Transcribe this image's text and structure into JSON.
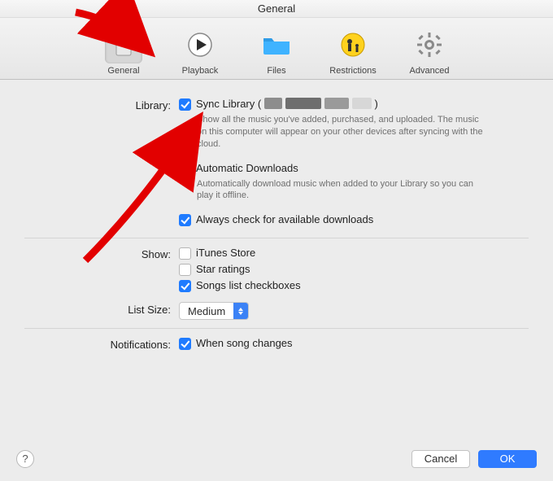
{
  "window": {
    "title": "General"
  },
  "toolbar": {
    "items": [
      {
        "key": "general",
        "label": "General",
        "selected": true
      },
      {
        "key": "playback",
        "label": "Playback",
        "selected": false
      },
      {
        "key": "files",
        "label": "Files",
        "selected": false
      },
      {
        "key": "restrictions",
        "label": "Restrictions",
        "selected": false
      },
      {
        "key": "advanced",
        "label": "Advanced",
        "selected": false
      }
    ]
  },
  "sections": {
    "library": {
      "label": "Library:",
      "sync": {
        "label_prefix": "Sync Library (",
        "label_suffix": ")",
        "checked": true,
        "desc": "Show all the music you've added, purchased, and uploaded. The music on this computer will appear on your other devices after syncing with the cloud."
      },
      "auto": {
        "label": "Automatic Downloads",
        "checked": true,
        "desc": "Automatically download music when added to your Library so you can play it offline."
      },
      "check": {
        "label": "Always check for available downloads",
        "checked": true
      }
    },
    "show": {
      "label": "Show:",
      "itunes": {
        "label": "iTunes Store",
        "checked": false
      },
      "stars": {
        "label": "Star ratings",
        "checked": false
      },
      "songcb": {
        "label": "Songs list checkboxes",
        "checked": true
      }
    },
    "listsize": {
      "label": "List Size:",
      "value": "Medium"
    },
    "notifications": {
      "label": "Notifications:",
      "songchange": {
        "label": "When song changes",
        "checked": true
      }
    }
  },
  "buttons": {
    "cancel": "Cancel",
    "ok": "OK",
    "help": "?"
  }
}
